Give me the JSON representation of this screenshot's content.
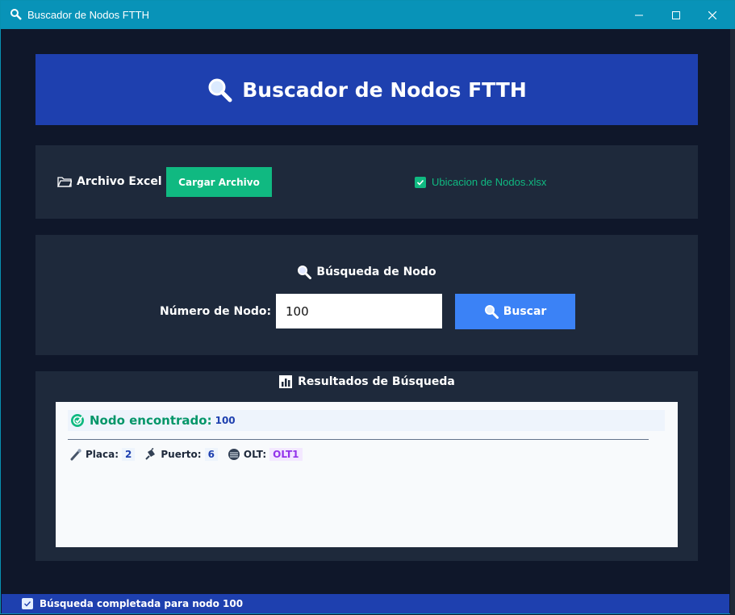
{
  "window": {
    "title": "Buscador de Nodos FTTH",
    "app_icon": "magnifier-icon",
    "controls": {
      "minimize": "minimize-icon",
      "maximize": "maximize-icon",
      "close": "close-icon"
    }
  },
  "header": {
    "title": "Buscador de Nodos FTTH",
    "icon": "magnifier-icon"
  },
  "file_panel": {
    "label": "Archivo Excel",
    "label_icon": "folder-icon",
    "load_button": "Cargar Archivo",
    "file_name": "Ubicacion de Nodos.xlsx",
    "file_loaded": true
  },
  "search_panel": {
    "title": "Búsqueda de Nodo",
    "node_label": "Número de Nodo:",
    "node_value": "100",
    "search_button": "Buscar"
  },
  "results": {
    "title": "Resultados de Búsqueda",
    "found_label": "Nodo encontrado:",
    "found_value": "100",
    "placa_label": "Placa:",
    "placa_value": "2",
    "puerto_label": "Puerto:",
    "puerto_value": "6",
    "olt_label": "OLT:",
    "olt_value": "OLT1"
  },
  "status": {
    "text": "Búsqueda completada para nodo 100"
  },
  "colors": {
    "title_bar": "#0893b8",
    "header": "#1e40af",
    "panel": "#1e293b",
    "green": "#10b981",
    "blue_button": "#3b82f6",
    "olt_purple": "#9333ea"
  }
}
